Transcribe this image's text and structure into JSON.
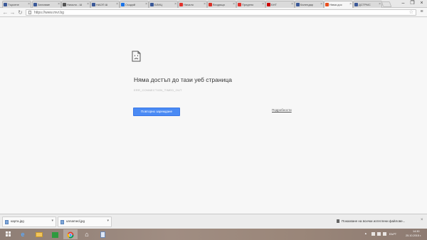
{
  "tabs": [
    {
      "label": "Търсене",
      "favicon_color": "#3b5998"
    },
    {
      "label": "Заглавие",
      "favicon_color": "#3b5998"
    },
    {
      "label": "Начало - Ш",
      "favicon_color": "#555555"
    },
    {
      "label": "НАОП Ш",
      "favicon_color": "#3b5998"
    },
    {
      "label": "Създай",
      "favicon_color": "#1a73e8"
    },
    {
      "label": "БЛИЦ",
      "favicon_color": "#3b5998"
    },
    {
      "label": "Начало",
      "favicon_color": "#e2312b"
    },
    {
      "label": "Входяща",
      "favicon_color": "#d93025"
    },
    {
      "label": "Предено",
      "favicon_color": "#e2312b"
    },
    {
      "label": "БНТ",
      "favicon_color": "#cc0000"
    },
    {
      "label": "Календар",
      "favicon_color": "#3b5998"
    },
    {
      "label": "Няма дос",
      "favicon_color": "#e8501f"
    },
    {
      "label": "ДСТРМС",
      "favicon_color": "#3b5998"
    }
  ],
  "active_tab_index": 11,
  "toolbar": {
    "url": "https://www.mvr.bg",
    "back_icon": "arrow-left-icon",
    "forward_icon": "arrow-right-icon",
    "reload_icon": "reload-icon"
  },
  "error_page": {
    "title": "Няма достъп до тази уеб страница",
    "error_code": "ERR_CONNECTION_TIMED_OUT",
    "reload_button": "Повторно зареждане",
    "details_link": "Подробности",
    "accent_color": "#4a8af4"
  },
  "downloads": {
    "items": [
      {
        "name": "карта.jpg"
      },
      {
        "name": "unnamed.jpg"
      }
    ],
    "show_all": "Показване на всички изтеглени файлове..."
  },
  "taskbar": {
    "apps": [
      "ie-icon",
      "explorer-icon",
      "store-icon",
      "chrome-icon",
      "home-icon",
      "notepad-icon"
    ],
    "language": "БЪРТ",
    "time": "14:30",
    "date": "25.10.2015 г."
  }
}
